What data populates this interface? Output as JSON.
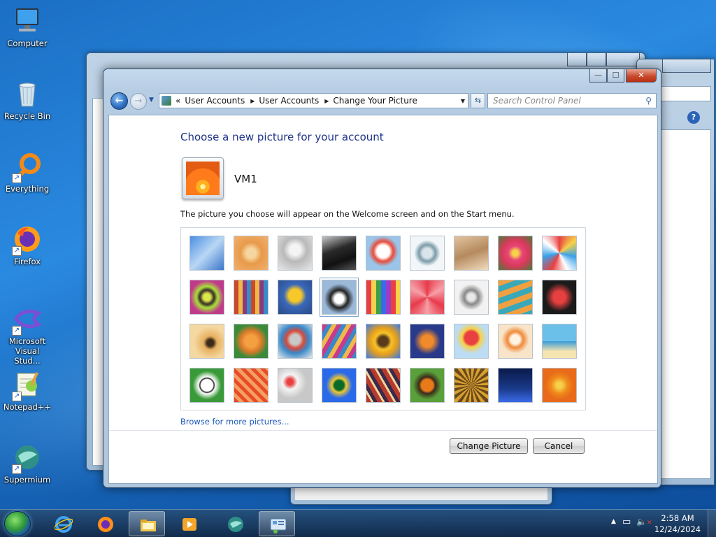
{
  "desktop": {
    "icons": [
      {
        "label": "Computer"
      },
      {
        "label": "Recycle Bin"
      },
      {
        "label": "Everything"
      },
      {
        "label": "Firefox"
      },
      {
        "label": "Microsoft Visual Stud..."
      },
      {
        "label": "Notepad++"
      },
      {
        "label": "Supermium"
      }
    ]
  },
  "window": {
    "title_buttons": {
      "minimize": "—",
      "maximize": "☐",
      "close": "✕"
    },
    "nav": {
      "breadcrumb_prefix": "«",
      "breadcrumbs": [
        "User Accounts",
        "User Accounts",
        "Change Your Picture"
      ],
      "search_placeholder": "Search Control Panel"
    },
    "heading": "Choose a new picture for your account",
    "username": "VM1",
    "description": "The picture you choose will appear on the Welcome screen and on the Start menu.",
    "browse_link": "Browse for more pictures...",
    "buttons": {
      "change": "Change Picture",
      "cancel": "Cancel"
    },
    "pictures": [
      "roller-coaster",
      "starfish",
      "robot-toy",
      "turntable",
      "lucky-cat",
      "gyroscope",
      "kitten",
      "flower-pink",
      "pinwheel",
      "ball-spiral",
      "fabric-stripes",
      "yellow-leaf",
      "dog-border-collie",
      "crayons",
      "red-star-leaf",
      "jacks",
      "orange-stairs",
      "paper-crane",
      "guitar",
      "pomeranian",
      "tin-robot",
      "scarves",
      "sunflower",
      "fish",
      "hot-air-balloon",
      "doll",
      "sailboat",
      "soccer-ball",
      "textile",
      "marbles",
      "green-window",
      "woven-rug",
      "butterfly",
      "basket-weave",
      "lighthouse",
      "orange-flower"
    ],
    "selected_picture": "dog-border-collie"
  },
  "taskbar": {
    "time": "2:58 AM",
    "date": "12/24/2024"
  }
}
